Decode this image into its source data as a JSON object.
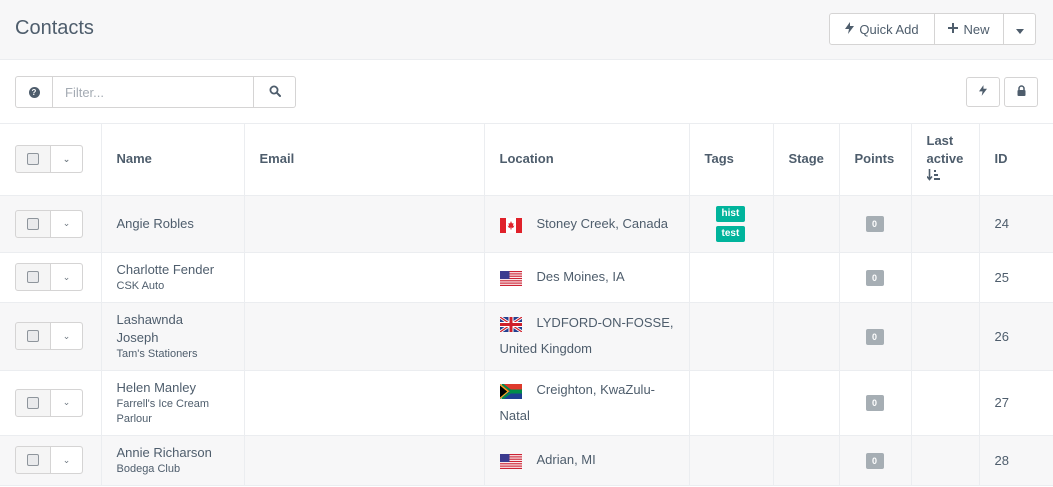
{
  "header": {
    "title": "Contacts",
    "quick_add_label": "Quick Add",
    "new_label": "New"
  },
  "toolbar": {
    "filter_placeholder": "Filter..."
  },
  "table": {
    "columns": {
      "name": "Name",
      "email": "Email",
      "location": "Location",
      "tags": "Tags",
      "stage": "Stage",
      "points": "Points",
      "last_active": "Last active",
      "id": "ID"
    },
    "rows": [
      {
        "name": "Angie Robles",
        "company": "",
        "email": "",
        "location_line1": "Stoney Creek, Canada",
        "location_line2": "",
        "flag": "canada-flag",
        "tags": [
          "hist",
          "test"
        ],
        "stage": "",
        "points": "0",
        "last_active": "",
        "id": "24"
      },
      {
        "name": "Charlotte Fender",
        "company": "CSK Auto",
        "email": "",
        "location_line1": "Des Moines, IA",
        "location_line2": "",
        "flag": "usa-flag",
        "tags": [],
        "stage": "",
        "points": "0",
        "last_active": "",
        "id": "25"
      },
      {
        "name": "Lashawnda Joseph",
        "company": "Tam's Stationers",
        "email": "",
        "location_line1": "LYDFORD-ON-FOSSE,",
        "location_line2": "United Kingdom",
        "flag": "uk-flag",
        "tags": [],
        "stage": "",
        "points": "0",
        "last_active": "",
        "id": "26"
      },
      {
        "name": "Helen Manley",
        "company": "Farrell's Ice Cream Parlour",
        "email": "",
        "location_line1": "Creighton, KwaZulu-",
        "location_line2": "Natal",
        "flag": "south-africa-flag",
        "tags": [],
        "stage": "",
        "points": "0",
        "last_active": "",
        "id": "27"
      },
      {
        "name": "Annie Richarson",
        "company": "Bodega Club",
        "email": "",
        "location_line1": "Adrian, MI",
        "location_line2": "",
        "flag": "usa-flag",
        "tags": [],
        "stage": "",
        "points": "0",
        "last_active": "",
        "id": "28"
      }
    ]
  },
  "colors": {
    "tag_bg": "#00b49c",
    "points_bg": "#a6aeb4",
    "text": "#4e5d6c",
    "header_bg": "#f7f7f8"
  },
  "icons": [
    "bolt-icon",
    "plus-icon",
    "caret-down-icon",
    "question-circle-icon",
    "search-icon",
    "lock-icon",
    "sort-amount-desc-icon"
  ]
}
